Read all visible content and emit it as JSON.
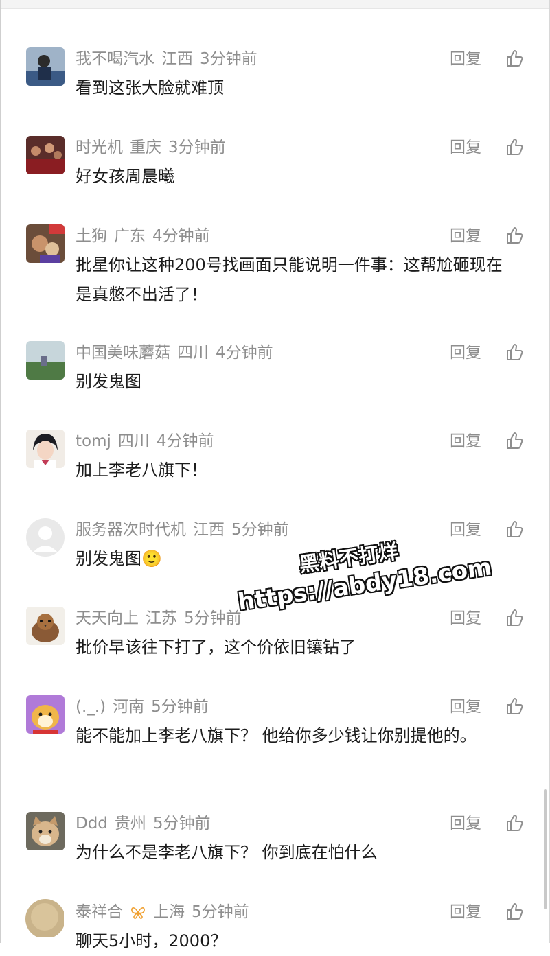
{
  "reply_label": "回复",
  "colors": {
    "meta_gray": "#8e8e8e",
    "text_dark": "#1c1c1c"
  },
  "comments": [
    {
      "user": "我不喝汽水",
      "location": "江西",
      "time": "3分钟前",
      "text": "看到这张大脸就难顶",
      "avatar": "avatar-photo-person-icon"
    },
    {
      "user": "时光机",
      "location": "重庆",
      "time": "3分钟前",
      "text": "好女孩周晨曦",
      "avatar": "avatar-photo-crowd-icon"
    },
    {
      "user": "土狗",
      "location": "广东",
      "time": "4分钟前",
      "text": "批星你让这种200号找画面只能说明一件事：这帮尬砸现在是真憋不出活了！",
      "avatar": "avatar-photo-dog-icon"
    },
    {
      "user": "中国美味蘑菇",
      "location": "四川",
      "time": "4分钟前",
      "text": "别发鬼图",
      "avatar": "avatar-photo-landscape-icon"
    },
    {
      "user": "tomj",
      "location": "四川",
      "time": "4分钟前",
      "text": "加上李老八旗下！",
      "avatar": "avatar-anime-girl-icon"
    },
    {
      "user": "服务器次时代机",
      "location": "江西",
      "time": "5分钟前",
      "text": "别发鬼图🙂",
      "avatar": "avatar-default-person-icon"
    },
    {
      "user": "天天向上",
      "location": "江苏",
      "time": "5分钟前",
      "text": "批价早该往下打了，这个价依旧镶钻了",
      "avatar": "avatar-bird-icon"
    },
    {
      "user": "(._.)",
      "location": "河南",
      "time": "5分钟前",
      "text": "能不能加上李老八旗下？ 他给你多少钱让你别提他的。",
      "avatar": "avatar-cartoon-dog-icon"
    },
    {
      "user": "Ddd",
      "location": "贵州",
      "time": "5分钟前",
      "text": "为什么不是李老八旗下？ 你到底在怕什么",
      "avatar": "avatar-cat-icon"
    },
    {
      "user": "泰祥合",
      "location": "上海",
      "time": "5分钟前",
      "text": "聊天5小时，2000？",
      "avatar": "avatar-photo-round-icon",
      "badge": "butterfly-badge-icon"
    }
  ],
  "watermark": {
    "line1": "黑料不打烊",
    "line2": "https://abdy18.com"
  }
}
